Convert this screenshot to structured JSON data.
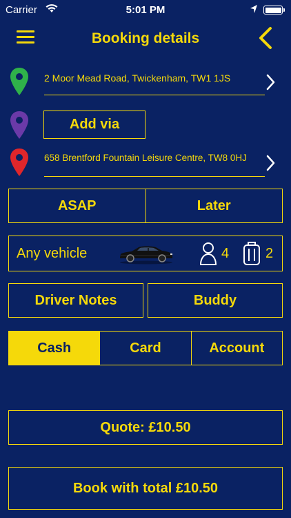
{
  "status": {
    "carrier": "Carrier",
    "time": "5:01 PM"
  },
  "nav": {
    "title": "Booking details"
  },
  "route": {
    "pickup": "2 Moor Mead Road, Twickenham, TW1 1JS",
    "add_via": "Add via",
    "dropoff": "658 Brentford Fountain Leisure Centre, TW8 0HJ"
  },
  "timing": {
    "asap": "ASAP",
    "later": "Later"
  },
  "vehicle": {
    "label": "Any vehicle",
    "passengers": "4",
    "luggage": "2"
  },
  "extras": {
    "driver_notes": "Driver Notes",
    "buddy": "Buddy"
  },
  "payment": {
    "cash": "Cash",
    "card": "Card",
    "account": "Account",
    "selected": "Cash"
  },
  "quote": {
    "label": "Quote: £10.50"
  },
  "book": {
    "label": "Book with total £10.50"
  },
  "colors": {
    "background": "#0a2263",
    "accent": "#f5d90a",
    "pickup_pin": "#2fb24a",
    "via_pin": "#6b3aa8",
    "dropoff_pin": "#e0262b"
  }
}
